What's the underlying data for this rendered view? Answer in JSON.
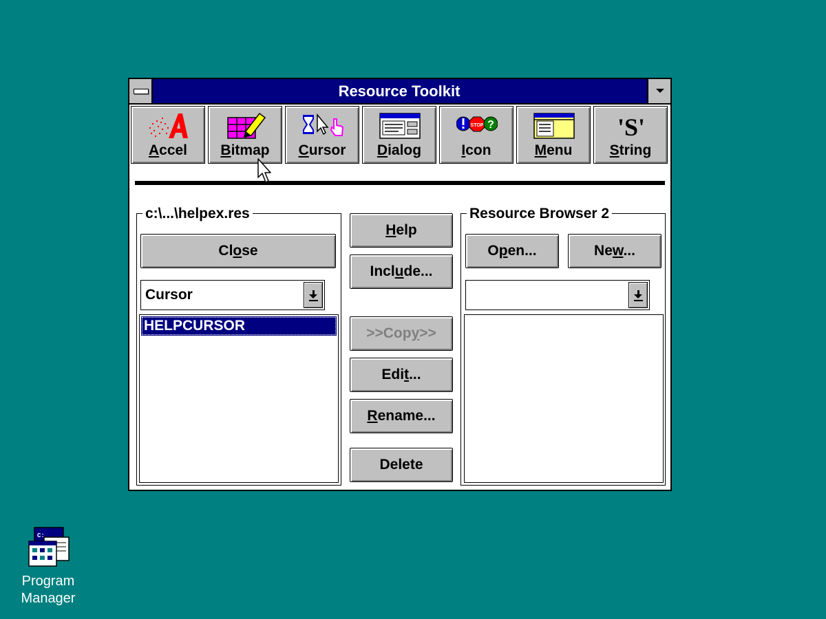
{
  "window": {
    "title": "Resource Toolkit"
  },
  "toolbar": {
    "buttons": [
      {
        "label": "Accel",
        "mnemonic": "A",
        "rest": "ccel",
        "icon": "accel-icon"
      },
      {
        "label": "Bitmap",
        "mnemonic": "B",
        "rest": "itmap",
        "icon": "bitmap-icon"
      },
      {
        "label": "Cursor",
        "mnemonic": "C",
        "rest": "ursor",
        "icon": "cursor-icon"
      },
      {
        "label": "Dialog",
        "mnemonic": "D",
        "rest": "ialog",
        "icon": "dialog-icon"
      },
      {
        "label": "Icon",
        "mnemonic": "I",
        "rest": "con",
        "icon": "icon-icon"
      },
      {
        "label": "Menu",
        "mnemonic": "M",
        "rest": "enu",
        "icon": "menu-icon"
      },
      {
        "label": "String",
        "mnemonic": "S",
        "rest": "tring",
        "icon": "string-icon"
      }
    ],
    "stop_text": "STOP",
    "string_glyph": "'S'"
  },
  "left_panel": {
    "title": "c:\\...\\helpex.res",
    "close": {
      "pre": "Cl",
      "mn": "o",
      "post": "se"
    },
    "type_combo": "Cursor",
    "list": [
      "HELPCURSOR"
    ]
  },
  "middle": {
    "help": {
      "pre": "",
      "mn": "H",
      "post": "elp"
    },
    "include": {
      "pre": "Incl",
      "mn": "u",
      "post": "de..."
    },
    "copy": {
      "pre": ">>Cop",
      "mn": "y",
      "post": ">>",
      "disabled": true
    },
    "edit": {
      "pre": "Edi",
      "mn": "t",
      "post": "..."
    },
    "rename": {
      "pre": "",
      "mn": "R",
      "post": "ename..."
    },
    "delete": {
      "label": "Delete"
    }
  },
  "right_panel": {
    "title": "Resource Browser 2",
    "open": {
      "pre": "O",
      "mn": "p",
      "post": "en..."
    },
    "new": {
      "pre": "Ne",
      "mn": "w",
      "post": "..."
    },
    "type_combo": "",
    "list": []
  },
  "desktop": {
    "icons": [
      {
        "line1": "Program",
        "line2": "Manager",
        "icon": "program-manager-icon",
        "mini_prompt": "C:"
      }
    ]
  },
  "colors": {
    "desktop": "#008080",
    "titlebar": "#000080",
    "button_face": "#c0c0c0",
    "selection": "#000080"
  }
}
